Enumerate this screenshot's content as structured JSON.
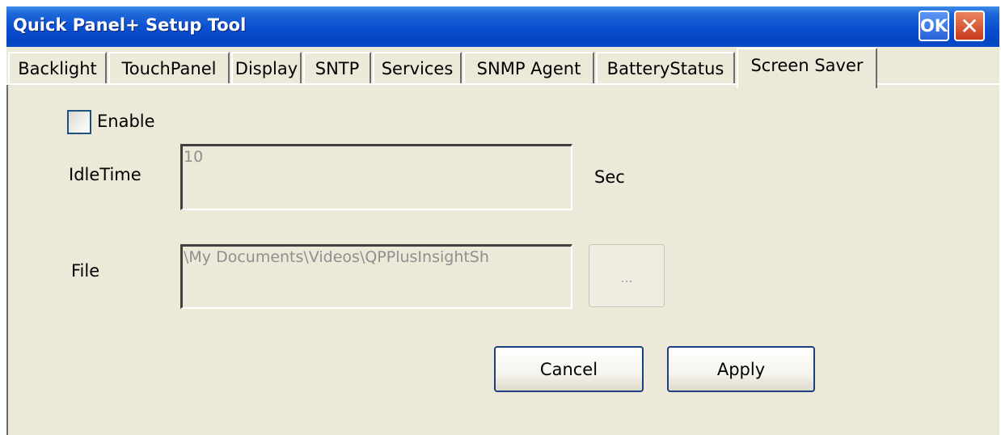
{
  "window": {
    "title": "Quick Panel+ Setup Tool",
    "ok_label": "OK",
    "close_label": "✕"
  },
  "tabs": [
    {
      "label": "Backlight"
    },
    {
      "label": "TouchPanel"
    },
    {
      "label": "Display"
    },
    {
      "label": "SNTP"
    },
    {
      "label": "Services"
    },
    {
      "label": "SNMP Agent"
    },
    {
      "label": "BatteryStatus"
    },
    {
      "label": "Screen Saver",
      "active": true
    }
  ],
  "screen_saver": {
    "enable_label": "Enable",
    "enable_checked": false,
    "idle_time_label": "IdleTime",
    "idle_time_value": "10",
    "idle_time_unit": "Sec",
    "file_label": "File",
    "file_value": "\\My Documents\\Videos\\QPPlusInsightSh",
    "browse_label": "..."
  },
  "buttons": {
    "cancel_label": "Cancel",
    "apply_label": "Apply"
  },
  "colors": {
    "titlebar": "#0a4fd0",
    "window_bg": "#ece9d8",
    "close_button": "#c9381a"
  }
}
